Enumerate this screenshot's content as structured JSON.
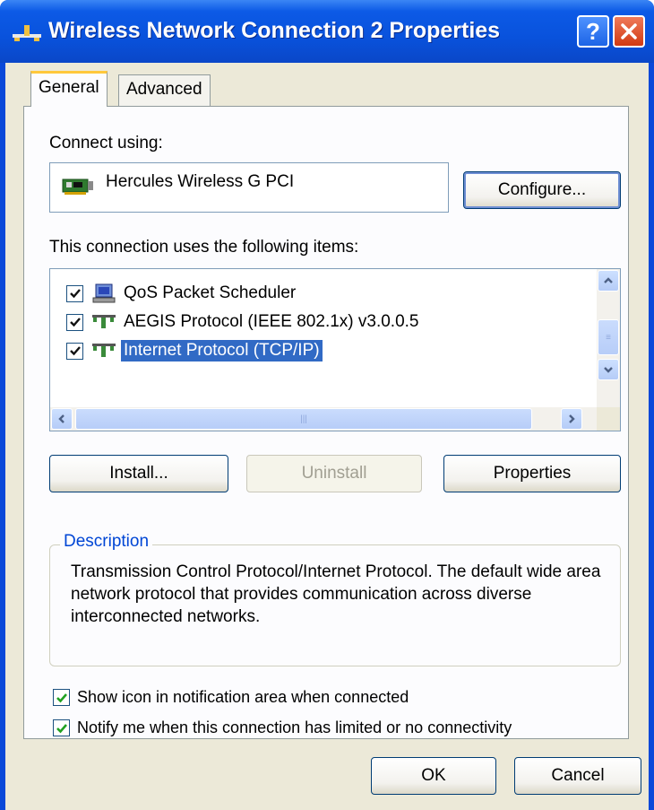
{
  "window": {
    "title": "Wireless Network Connection 2 Properties",
    "help_glyph": "?",
    "accent": "#0a49d9"
  },
  "tabs": [
    {
      "label": "General",
      "active": true
    },
    {
      "label": "Advanced",
      "active": false
    }
  ],
  "general": {
    "connect_using_label": "Connect using:",
    "adapter_name": "Hercules Wireless G PCI",
    "configure_button": "Configure...",
    "items_label": "This connection uses the following items:",
    "items": [
      {
        "label": "QoS Packet Scheduler",
        "checked": true,
        "icon": "scheduler-icon",
        "selected": false
      },
      {
        "label": "AEGIS Protocol (IEEE 802.1x) v3.0.0.5",
        "checked": true,
        "icon": "network-protocol-icon",
        "selected": false
      },
      {
        "label": "Internet Protocol (TCP/IP)",
        "checked": true,
        "icon": "network-protocol-icon",
        "selected": true
      }
    ],
    "install_button": "Install...",
    "uninstall_button": "Uninstall",
    "properties_button": "Properties",
    "description_label": "Description",
    "description_text": "Transmission Control Protocol/Internet Protocol. The default wide area network protocol that provides communication across diverse interconnected networks.",
    "show_icon_option": {
      "label": "Show icon in notification area when connected",
      "checked": true
    },
    "notify_option": {
      "label": "Notify me when this connection has limited or no connectivity",
      "checked": true
    }
  },
  "footer": {
    "ok_button": "OK",
    "cancel_button": "Cancel"
  }
}
